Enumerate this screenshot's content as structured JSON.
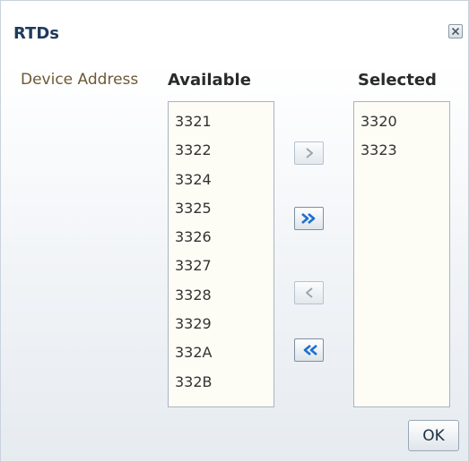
{
  "dialog": {
    "title": "RTDs",
    "close_icon": "close-icon"
  },
  "field": {
    "label": "Device Address"
  },
  "available": {
    "header": "Available",
    "items": [
      "3321",
      "3322",
      "3324",
      "3325",
      "3326",
      "3327",
      "3328",
      "3329",
      "332A",
      "332B"
    ]
  },
  "selected": {
    "header": "Selected",
    "items": [
      "3320",
      "3323"
    ]
  },
  "shuttle": {
    "move_icon": "chevron-right-icon",
    "move_all_icon": "double-chevron-right-icon",
    "remove_icon": "chevron-left-icon",
    "remove_all_icon": "double-chevron-left-icon",
    "active_color": "#1e6fd0",
    "disabled_color": "#9aa5b1"
  },
  "footer": {
    "ok_label": "OK"
  }
}
